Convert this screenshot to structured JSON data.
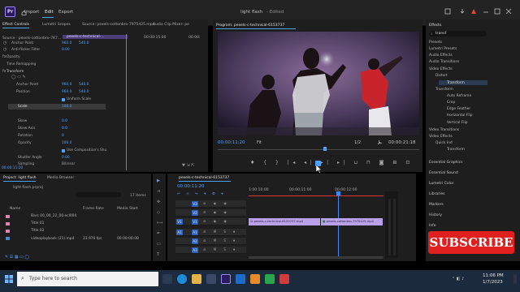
{
  "app": {
    "logo": "Pr",
    "title": "light flash",
    "status": "- Edited"
  },
  "menu": {
    "import": "Import",
    "edit": "Edit",
    "export": "Export"
  },
  "effect_controls": {
    "tabs": [
      "Effect Controls",
      "Lumetri Scopes",
      "Source: pexels-cottonbro-7975425.mp4",
      "Audio Clip Mixer: pe"
    ],
    "source": "Source · pexels-cottonbro-7K7...",
    "clip_name": "pexels-c-technical-...",
    "ruler_times": [
      "00:00:15:00",
      "00:00:"
    ],
    "rows": [
      {
        "label": "Anchor Point",
        "v1": "960.0",
        "v2": "540.0"
      },
      {
        "label": "Anti-flicker Filter",
        "v1": "0.00"
      },
      {
        "label": "Opacity"
      },
      {
        "label": "Time Remapping"
      },
      {
        "label": "Transform"
      },
      {
        "label": "Anchor Point",
        "v1": "960.0",
        "v2": "540.0"
      },
      {
        "label": "Position",
        "v1": "960.0",
        "v2": "540.0"
      },
      {
        "label": "Uniform Scale"
      },
      {
        "label": "Scale",
        "v1": "100.0"
      },
      {
        "label": "Skew",
        "v1": "0.0"
      },
      {
        "label": "Skew Axis",
        "v1": "0.0"
      },
      {
        "label": "Rotation",
        "v1": "0"
      },
      {
        "label": "Opacity",
        "v1": "100.0"
      },
      {
        "label": "Use Composition's Shu"
      },
      {
        "label": "Shutter Angle",
        "v1": "0.00"
      },
      {
        "label": "Sampling",
        "v1": "Bilinear"
      }
    ],
    "timecode": "00:00:11:20"
  },
  "program": {
    "title": "Program: pexels-c-technical-6153737",
    "timecode": "00:00:11:20",
    "fit": "Fit",
    "quality": "1/2",
    "duration": "00:00:21:18"
  },
  "project": {
    "tabs": [
      "Project: light flash",
      "Media Browser"
    ],
    "file": "light flash.prproj",
    "count": "17 items",
    "columns": [
      "Name",
      "Frame Rate",
      "Media Start"
    ],
    "items": [
      {
        "name": "Bars 00_00_22_00.ecl004",
        "rate": "",
        "start": "",
        "color": "#e87fb0"
      },
      {
        "name": "Title 01",
        "rate": "",
        "start": "",
        "color": "#e87fb0"
      },
      {
        "name": "Title 02",
        "rate": "",
        "start": "",
        "color": "#e87fb0"
      },
      {
        "name": "videoplayback (21).mp4",
        "rate": "23.976 fps",
        "start": "00:00:00:00",
        "color": "#3f8bd8"
      }
    ]
  },
  "timeline": {
    "tab": "pexels-c-technical-6153737",
    "timecode": "00:00:11:20",
    "ruler": [
      "1:00:10:00",
      "00:00:11:00",
      "00:00:12:00"
    ],
    "video_tracks": [
      "V3",
      "V2",
      "V1"
    ],
    "audio_tracks": [
      "A1",
      "A2",
      "A3"
    ],
    "clip1": "pexels-c-technical-6153737.mp4",
    "clip2": "pexels-cottonbro-7975425.mp4"
  },
  "effects": {
    "title": "Effects",
    "search": "transf",
    "tree": [
      "Presets",
      "Lumetri Presets",
      "Audio Effects",
      "Audio Transitions",
      "Video Effects",
      "Distort",
      "Transform",
      "Transform",
      "Auto Reframe",
      "Crop",
      "Edge Feather",
      "Horizontal Flip",
      "Vertical Flip",
      "Video Transitions",
      "Video Effects",
      "Quick Ind",
      "Transform"
    ],
    "sections": [
      "Essential Graphics",
      "Essential Sound",
      "Lumetri Color",
      "Libraries",
      "Markers",
      "History",
      "Info"
    ]
  },
  "subscribe": "SUBSCRIBE",
  "taskbar": {
    "search": "Type here to search",
    "time": "11:06 PM",
    "date": "1/7/2023"
  }
}
